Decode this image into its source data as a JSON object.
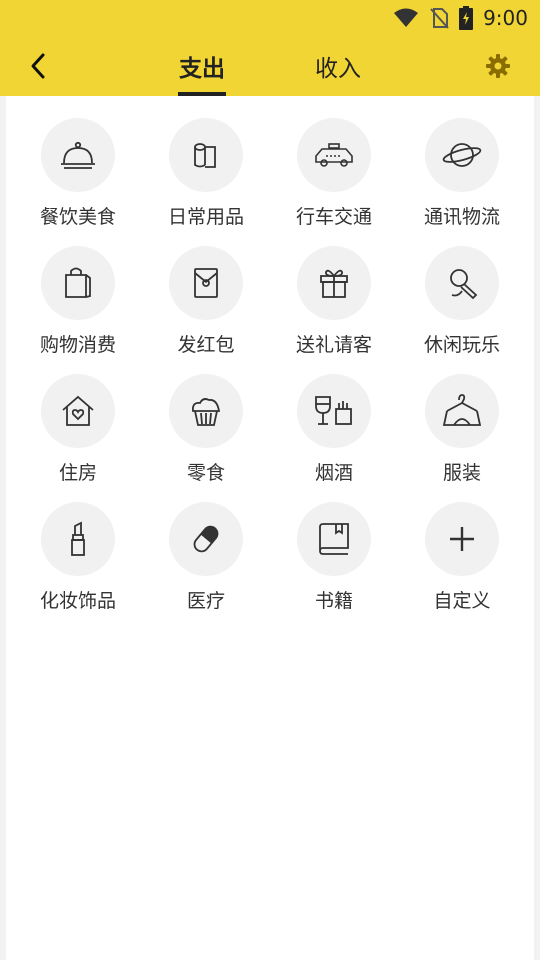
{
  "status": {
    "time": "9:00"
  },
  "tabs": [
    {
      "label": "支出",
      "active": true
    },
    {
      "label": "收入",
      "active": false
    }
  ],
  "categories": [
    {
      "label": "餐饮美食",
      "icon": "food-cloche-icon"
    },
    {
      "label": "日常用品",
      "icon": "tissue-roll-icon"
    },
    {
      "label": "行车交通",
      "icon": "taxi-icon"
    },
    {
      "label": "通讯物流",
      "icon": "planet-icon"
    },
    {
      "label": "购物消费",
      "icon": "shopping-bag-icon"
    },
    {
      "label": "发红包",
      "icon": "red-envelope-icon"
    },
    {
      "label": "送礼请客",
      "icon": "gift-icon"
    },
    {
      "label": "休闲玩乐",
      "icon": "microphone-icon"
    },
    {
      "label": "住房",
      "icon": "house-heart-icon"
    },
    {
      "label": "零食",
      "icon": "cupcake-icon"
    },
    {
      "label": "烟酒",
      "icon": "wine-cigarette-icon"
    },
    {
      "label": "服装",
      "icon": "clothes-hanger-icon"
    },
    {
      "label": "化妆饰品",
      "icon": "lipstick-icon"
    },
    {
      "label": "医疗",
      "icon": "pill-icon"
    },
    {
      "label": "书籍",
      "icon": "book-icon"
    },
    {
      "label": "自定义",
      "icon": "plus-icon"
    }
  ],
  "colors": {
    "accent": "#f1d534",
    "icon_bg": "#f1f1f1",
    "text": "#333333"
  }
}
